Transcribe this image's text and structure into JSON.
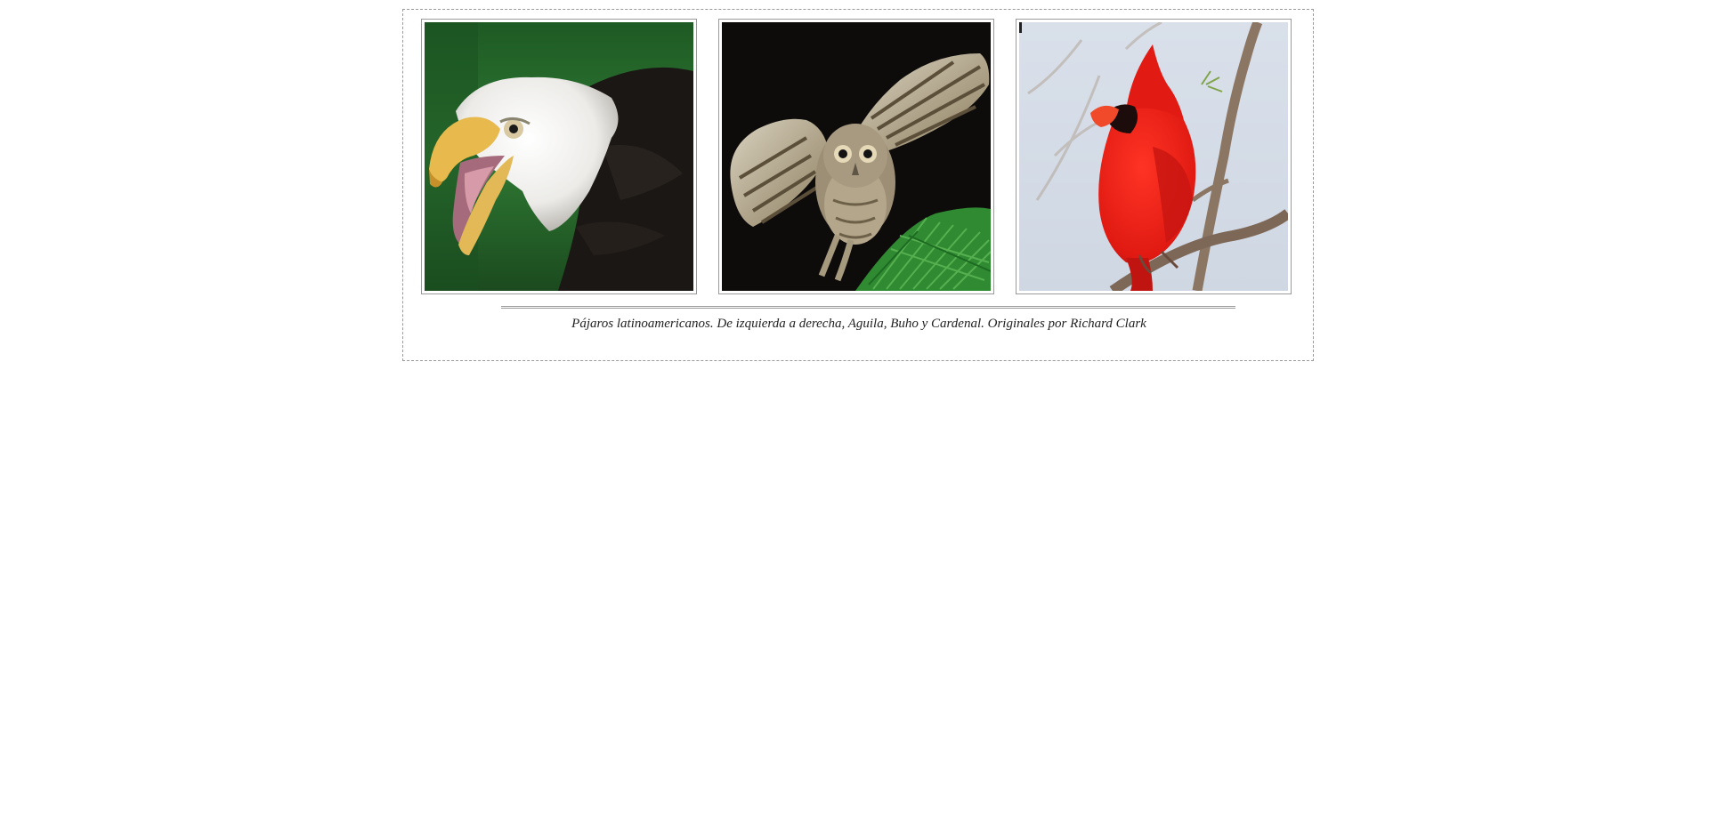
{
  "gallery": {
    "images": [
      {
        "name": "Aguila",
        "icon": "eagle-photo"
      },
      {
        "name": "Buho",
        "icon": "owl-photo"
      },
      {
        "name": "Cardenal",
        "icon": "cardinal-photo"
      }
    ],
    "caption": "Pájaros latinoamericanos. De izquierda a derecha, Aguila, Buho y Cardenal. Originales por Richard Clark"
  },
  "colors": {
    "frame_border": "#9a9a9a",
    "caption_text": "#222222",
    "background": "#ffffff"
  }
}
